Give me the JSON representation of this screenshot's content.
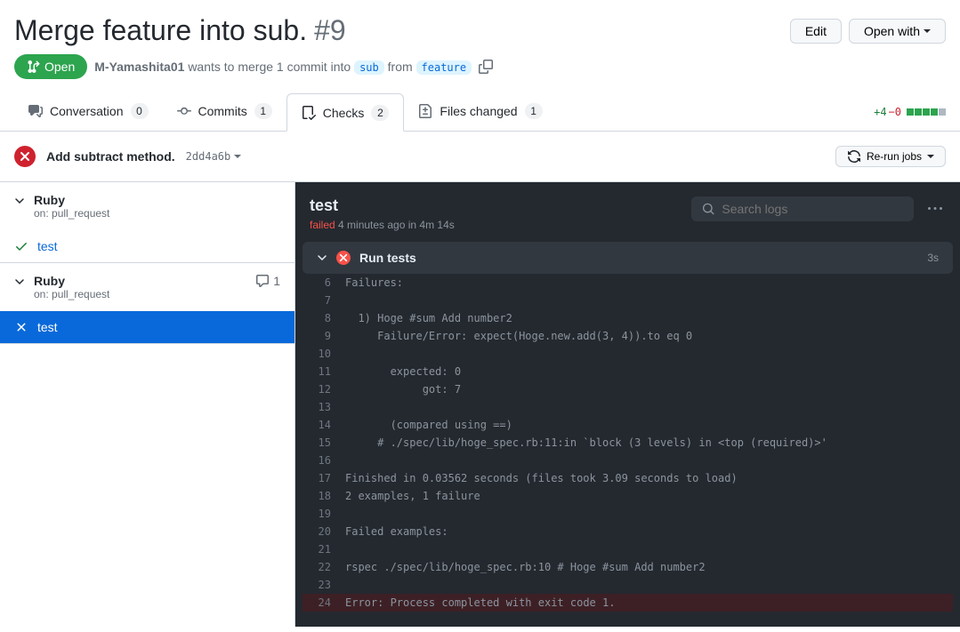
{
  "pr": {
    "title": "Merge feature into sub.",
    "number": "#9",
    "state": "Open",
    "author": "M-Yamashita01",
    "merge_text_1": "wants to merge 1 commit into",
    "base": "sub",
    "merge_text_2": "from",
    "head": "feature"
  },
  "actions": {
    "edit": "Edit",
    "open_with": "Open with"
  },
  "tabs": {
    "conversation": {
      "label": "Conversation",
      "count": "0"
    },
    "commits": {
      "label": "Commits",
      "count": "1"
    },
    "checks": {
      "label": "Checks",
      "count": "2"
    },
    "files": {
      "label": "Files changed",
      "count": "1"
    }
  },
  "diffstat": {
    "add": "+4",
    "del": "−0"
  },
  "commit": {
    "title": "Add subtract method.",
    "sha": "2dd4a6b",
    "rerun": "Re-run jobs"
  },
  "workflows": [
    {
      "name": "Ruby",
      "sub": "on: pull_request",
      "jobs": [
        {
          "name": "test",
          "status": "success"
        }
      ],
      "annotations": null
    },
    {
      "name": "Ruby",
      "sub": "on: pull_request",
      "jobs": [
        {
          "name": "test",
          "status": "failure",
          "selected": true
        }
      ],
      "annotations": "1"
    }
  ],
  "log": {
    "title": "test",
    "status_prefix": "failed",
    "status_rest": " 4 minutes ago in 4m 14s",
    "search_placeholder": "Search logs",
    "step": {
      "name": "Run tests",
      "duration": "3s"
    },
    "lines": [
      {
        "n": "6",
        "t": "Failures:"
      },
      {
        "n": "7",
        "t": ""
      },
      {
        "n": "8",
        "t": "  1) Hoge #sum Add number2"
      },
      {
        "n": "9",
        "t": "     Failure/Error: expect(Hoge.new.add(3, 4)).to eq 0"
      },
      {
        "n": "10",
        "t": ""
      },
      {
        "n": "11",
        "t": "       expected: 0"
      },
      {
        "n": "12",
        "t": "            got: 7"
      },
      {
        "n": "13",
        "t": ""
      },
      {
        "n": "14",
        "t": "       (compared using ==)"
      },
      {
        "n": "15",
        "t": "     # ./spec/lib/hoge_spec.rb:11:in `block (3 levels) in <top (required)>'"
      },
      {
        "n": "16",
        "t": ""
      },
      {
        "n": "17",
        "t": "Finished in 0.03562 seconds (files took 3.09 seconds to load)"
      },
      {
        "n": "18",
        "t": "2 examples, 1 failure"
      },
      {
        "n": "19",
        "t": ""
      },
      {
        "n": "20",
        "t": "Failed examples:"
      },
      {
        "n": "21",
        "t": ""
      },
      {
        "n": "22",
        "t": "rspec ./spec/lib/hoge_spec.rb:10 # Hoge #sum Add number2"
      },
      {
        "n": "23",
        "t": ""
      },
      {
        "n": "24",
        "t": "Process completed with exit code 1.",
        "err": true,
        "prefix": "Error: "
      }
    ]
  }
}
